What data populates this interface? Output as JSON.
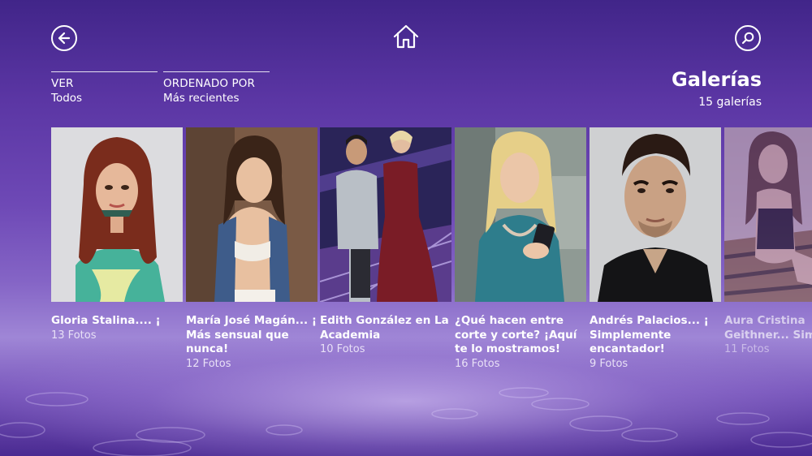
{
  "nav": {
    "back_icon": "arrow-left-icon",
    "home_icon": "home-icon",
    "search_icon": "search-icon"
  },
  "filters": {
    "view": {
      "label": "VER",
      "value": "Todos"
    },
    "order": {
      "label": "ORDENADO POR",
      "value": "Más recientes"
    }
  },
  "header": {
    "title": "Galerías",
    "count": "15 galerías"
  },
  "galleries": [
    {
      "title": "Gloria Stalina.... ¡",
      "count": "13 Fotos"
    },
    {
      "title": "María José Magán... ¡\nMás sensual que\nnunca!",
      "count": "12 Fotos"
    },
    {
      "title": "Edith González en La\nAcademia",
      "count": "10 Fotos"
    },
    {
      "title": "¿Qué hacen entre\ncorte y corte? ¡Aquí\nte lo mostramos!",
      "count": "16 Fotos"
    },
    {
      "title": "Andrés Palacios... ¡\nSimplemente\nencantador!",
      "count": "9 Fotos"
    },
    {
      "title": "Aura Cristina\nGeithner... Simp",
      "count": "11 Fotos"
    }
  ],
  "colors": {
    "background_top": "#412589",
    "background_mid": "#6e49b6",
    "text": "#ffffff"
  }
}
